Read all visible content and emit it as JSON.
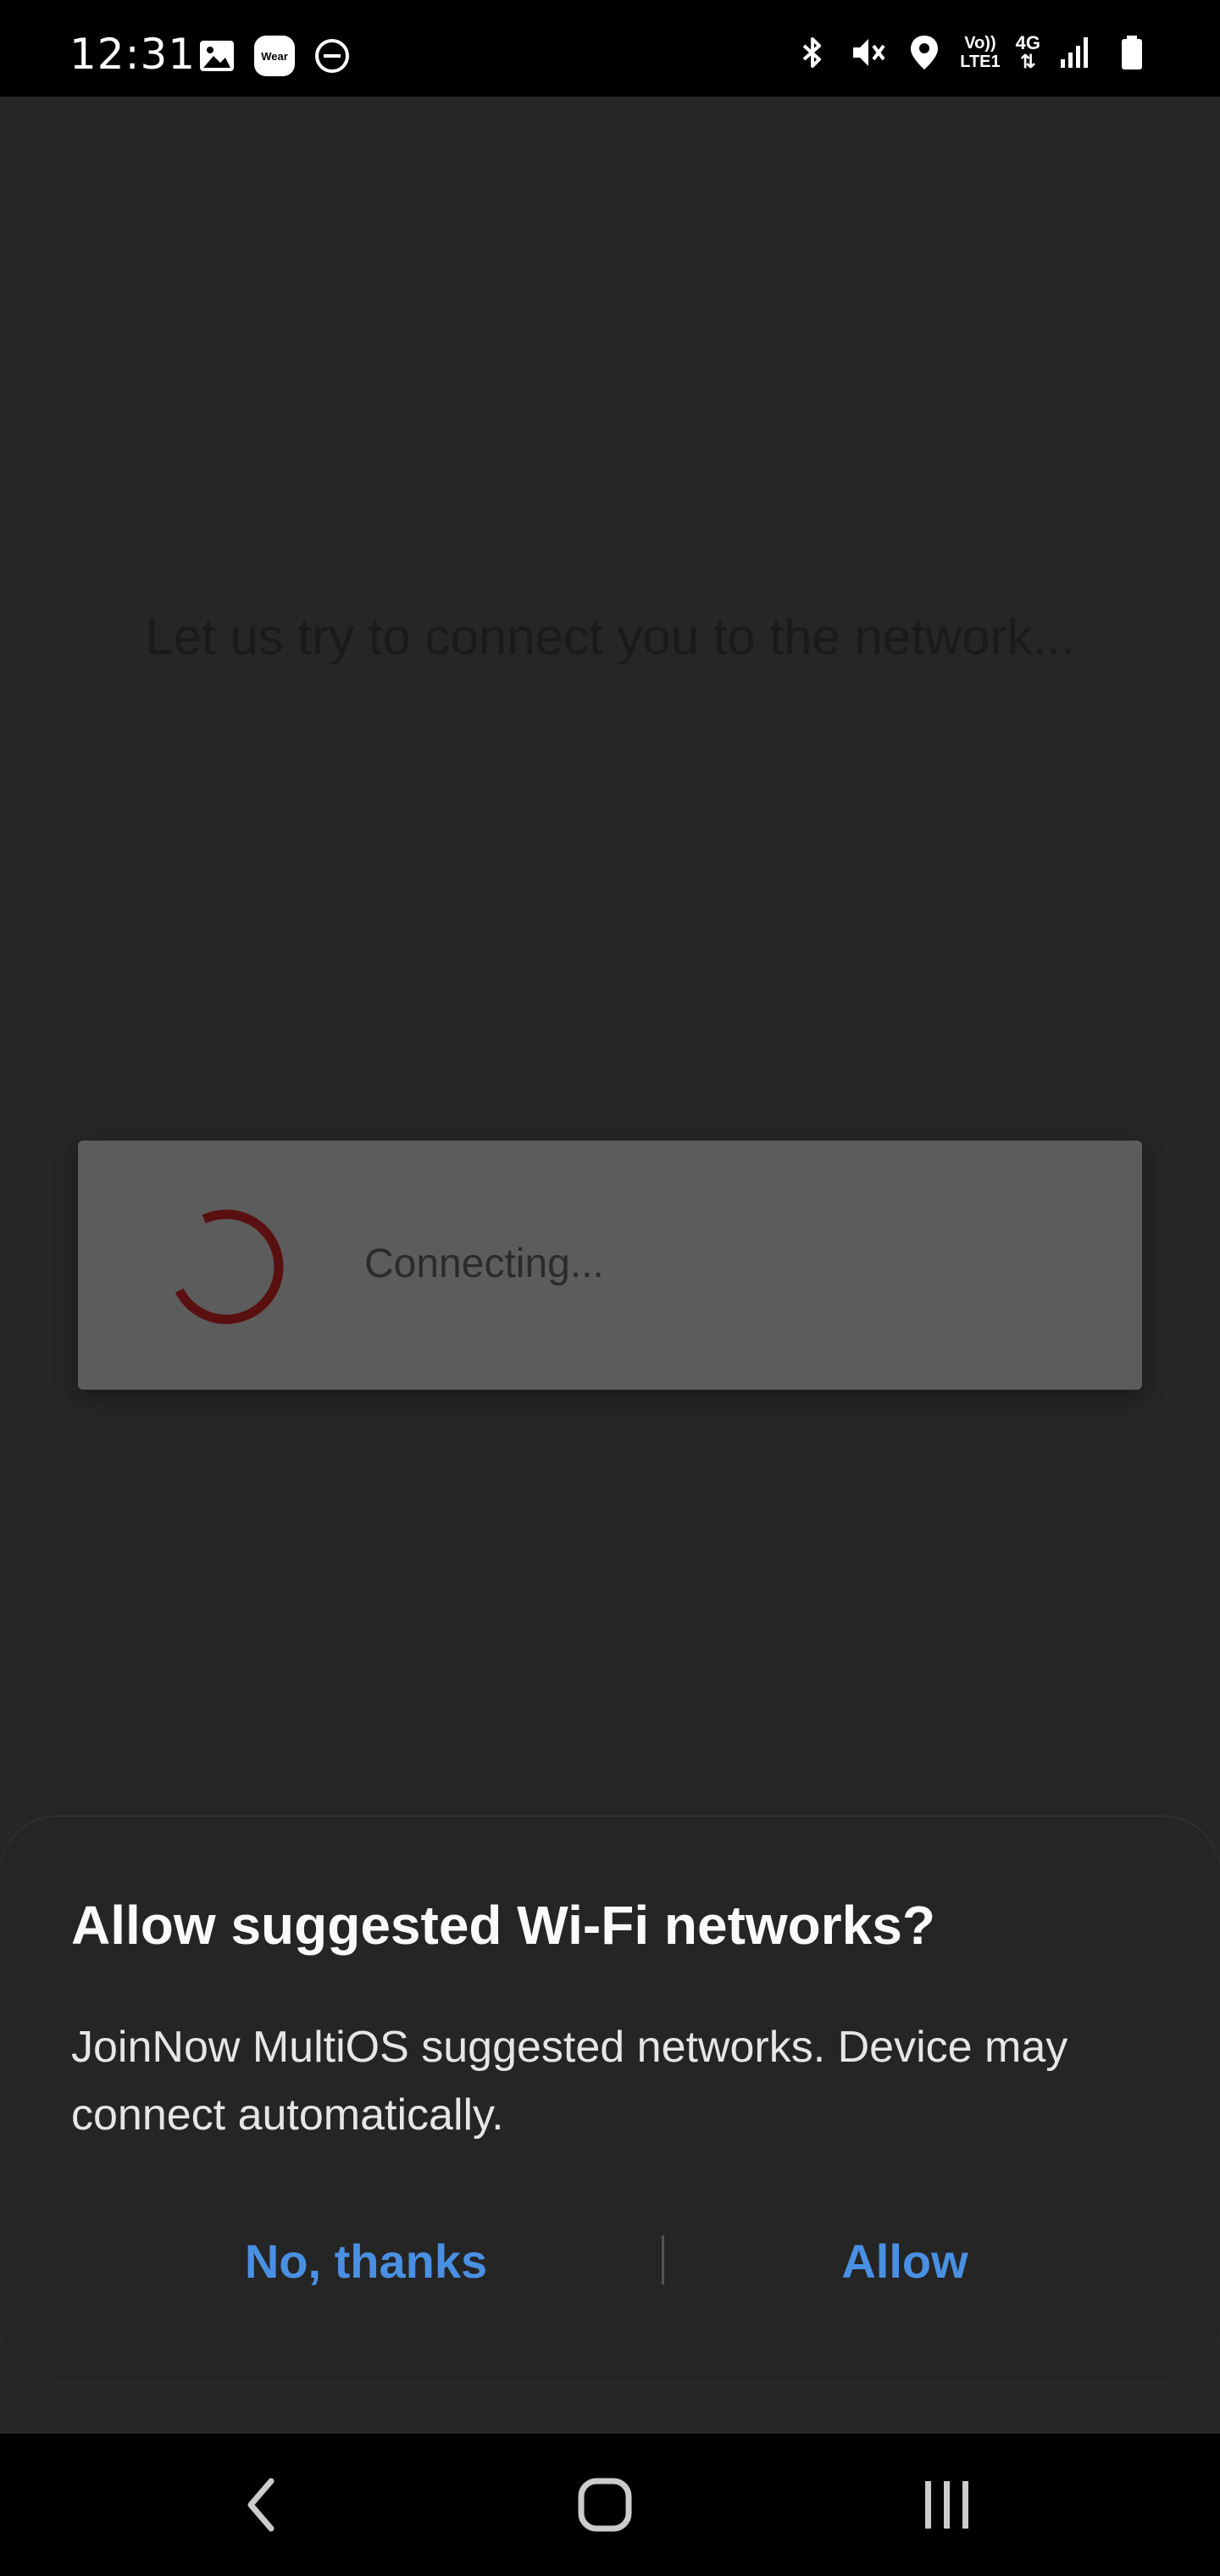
{
  "status_bar": {
    "time": "12:31",
    "wear_label": "Wear",
    "volte_label_top": "Vo))",
    "volte_label_bottom": "LTE1",
    "network_label": "4G"
  },
  "screen": {
    "background_message": "Let us try to connect you to the network...",
    "progress_text": "Connecting..."
  },
  "dialog": {
    "title": "Allow suggested Wi-Fi networks?",
    "body": "JoinNow MultiOS suggested networks. Device may connect automatically.",
    "negative_label": "No, thanks",
    "positive_label": "Allow"
  },
  "colors": {
    "accent": "#4a90e2",
    "spinner": "#5a1010"
  },
  "icons": {
    "nav_back": "back-chevron-icon",
    "nav_home": "home-icon",
    "nav_recents": "recents-icon"
  }
}
